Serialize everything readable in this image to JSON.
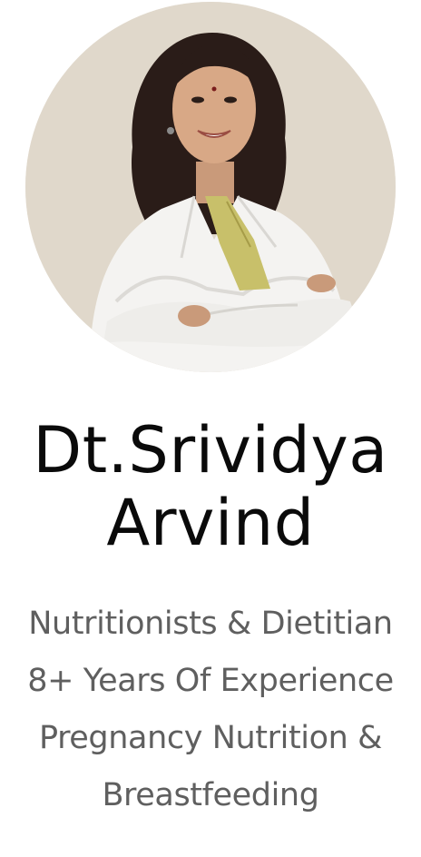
{
  "profile": {
    "name_line1": "Dt.Srividya",
    "name_line2": "Arvind",
    "details": [
      "Nutritionists & Dietitian",
      "8+ Years Of Experience",
      "Pregnancy Nutrition &",
      "Breastfeeding"
    ]
  },
  "colors": {
    "name_text": "#0a0a0a",
    "detail_text": "#5f5f5f",
    "photo_background": "#ddd5c7",
    "coat": "#f4f3f1",
    "scarf": "#c8c06a",
    "hair": "#2a1c18"
  }
}
